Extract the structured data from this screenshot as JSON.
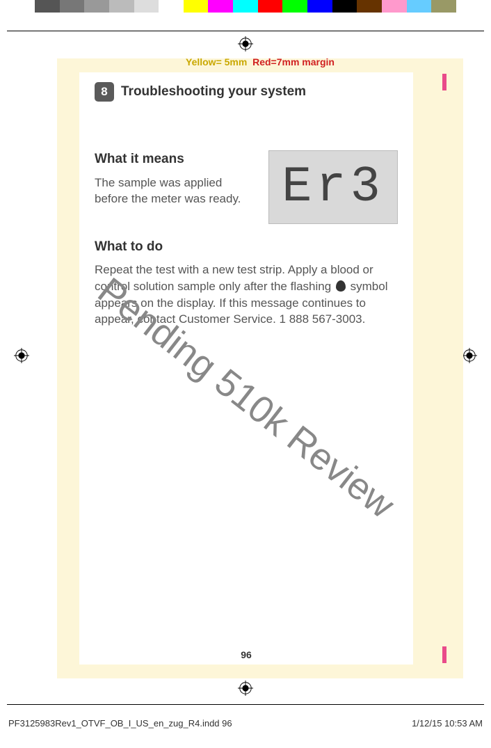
{
  "color_swatches": [
    "#555555",
    "#777777",
    "#999999",
    "#bbbbbb",
    "#dddddd",
    "#ffffff",
    "#ffff00",
    "#ff00ff",
    "#00ffff",
    "#ff0000",
    "#00ff00",
    "#0000ff",
    "#000000",
    "#663300",
    "#ff99cc",
    "#66ccff",
    "#999966"
  ],
  "margin_label": {
    "yellow": "Yellow= 5mm",
    "red": "Red=7mm margin"
  },
  "chapter": {
    "number": "8",
    "title": "Troubleshooting your system"
  },
  "section1": {
    "heading": "What it means",
    "body": "The sample was applied before the meter was ready."
  },
  "lcd_display": "Er3",
  "section2": {
    "heading": "What to do",
    "body_pre": "Repeat the test with a new test strip. Apply a blood or control solution sample only after the flashing ",
    "body_post": " symbol appears on the display. If this message continues to appear, contact Customer Service. 1 888 567-3003."
  },
  "watermark": "Pending 510k Review",
  "page_number": "96",
  "footer": {
    "file": "PF3125983Rev1_OTVF_OB_I_US_en_zug_R4.indd   96",
    "timestamp": "1/12/15   10:53 AM"
  }
}
